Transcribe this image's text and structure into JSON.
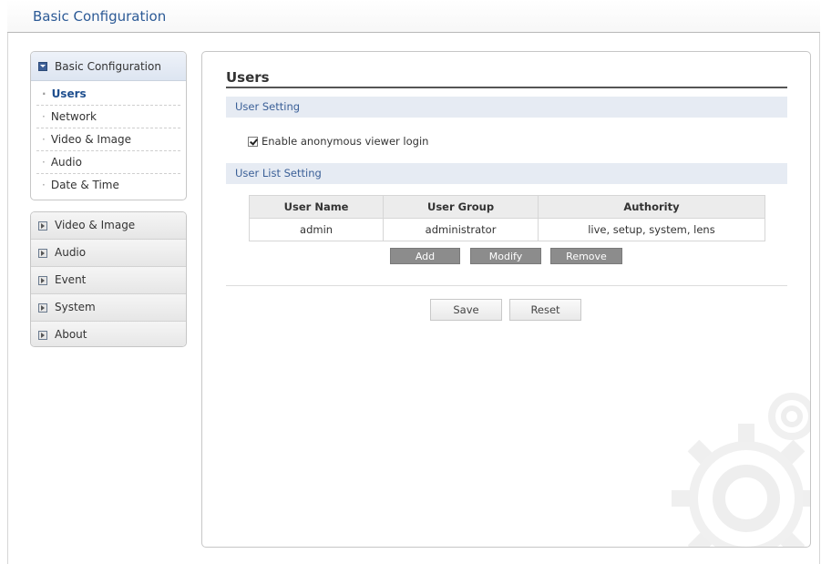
{
  "app": {
    "title": "Basic Configuration"
  },
  "sidebar": {
    "section": {
      "label": "Basic Configuration",
      "items": [
        {
          "label": "Users",
          "active": true
        },
        {
          "label": "Network"
        },
        {
          "label": "Video & Image"
        },
        {
          "label": "Audio"
        },
        {
          "label": "Date & Time"
        }
      ]
    },
    "menu": [
      {
        "label": "Video & Image"
      },
      {
        "label": "Audio"
      },
      {
        "label": "Event"
      },
      {
        "label": "System"
      },
      {
        "label": "About"
      }
    ]
  },
  "main": {
    "title": "Users",
    "user_setting": {
      "header": "User Setting",
      "anonymous_label": "Enable anonymous viewer login",
      "anonymous_checked": true
    },
    "user_list": {
      "header": "User List Setting",
      "columns": [
        "User Name",
        "User Group",
        "Authority"
      ],
      "rows": [
        [
          "admin",
          "administrator",
          "live, setup, system, lens"
        ]
      ],
      "add_label": "Add",
      "modify_label": "Modify",
      "remove_label": "Remove"
    },
    "save_label": "Save",
    "reset_label": "Reset"
  },
  "colors": {
    "accent": "#2c5a96",
    "section_bar": "#e6ebf3",
    "dark_button": "#8c8c8c"
  },
  "icons": {
    "section_open": "expanded-box-icon",
    "section_closed": "collapsed-box-icon",
    "watermark": "gear-icon"
  }
}
